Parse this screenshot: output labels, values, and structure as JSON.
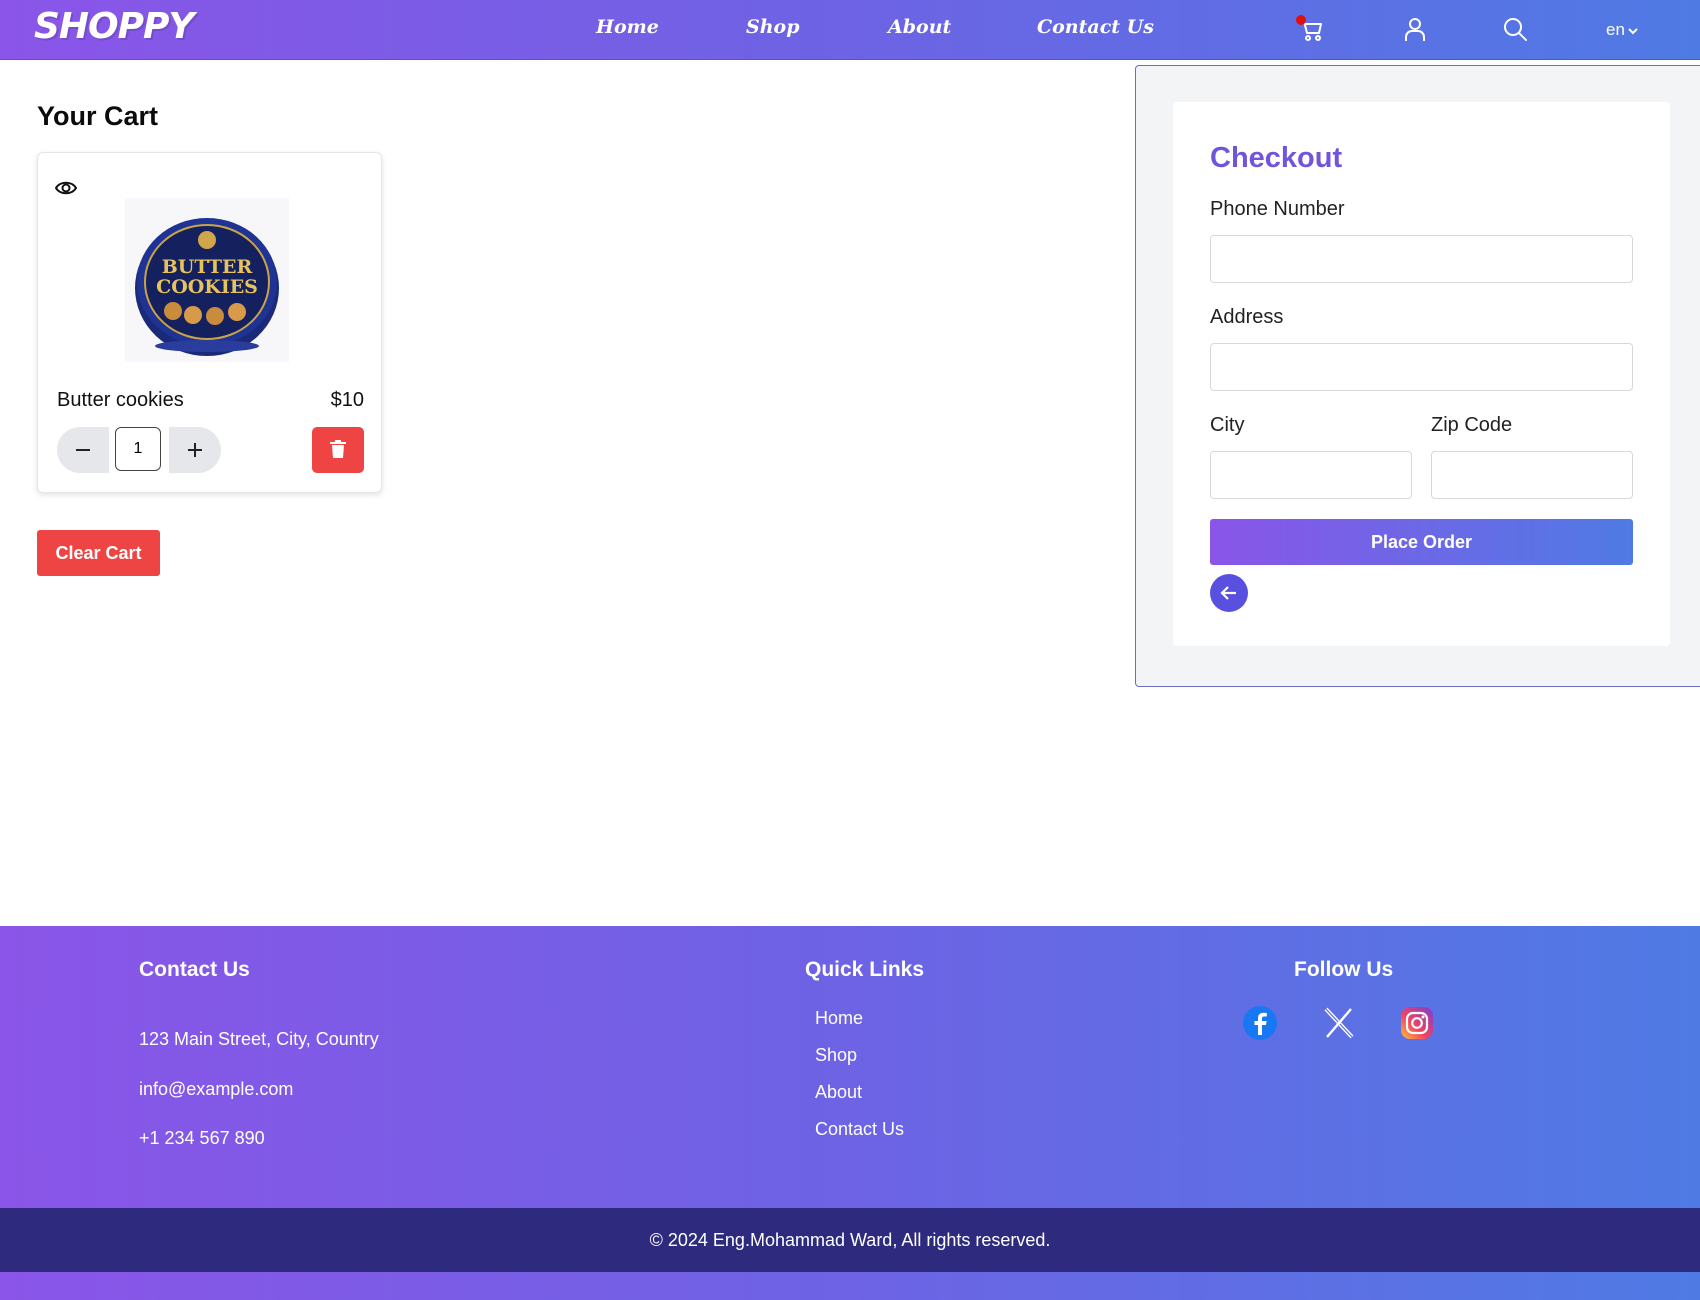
{
  "nav": {
    "logo": "SHOPPY",
    "links": [
      "Home",
      "Shop",
      "About",
      "Contact Us"
    ],
    "language": "en"
  },
  "cart": {
    "title": "Your Cart",
    "item": {
      "name": "Butter cookies",
      "price": "$10",
      "quantity": "1"
    },
    "clear_label": "Clear Cart"
  },
  "checkout": {
    "title": "Checkout",
    "phone_label": "Phone Number",
    "address_label": "Address",
    "city_label": "City",
    "zip_label": "Zip Code",
    "place_order_label": "Place Order"
  },
  "footer": {
    "contact_heading": "Contact Us",
    "address": "123 Main Street, City, Country",
    "email": "info@example.com",
    "phone": "+1 234 567 890",
    "links_heading": "Quick Links",
    "links": [
      "Home",
      "Shop",
      "About",
      "Contact Us"
    ],
    "follow_heading": "Follow Us",
    "copyright": "© 2024 Eng.Mohammad Ward, All rights reserved."
  },
  "colors": {
    "brand_gradient_start": "#8a55e8",
    "brand_gradient_end": "#4f7ae4",
    "danger": "#ef4444",
    "checkout_title": "#7055db",
    "footer_bottom": "#2e2a7e"
  }
}
